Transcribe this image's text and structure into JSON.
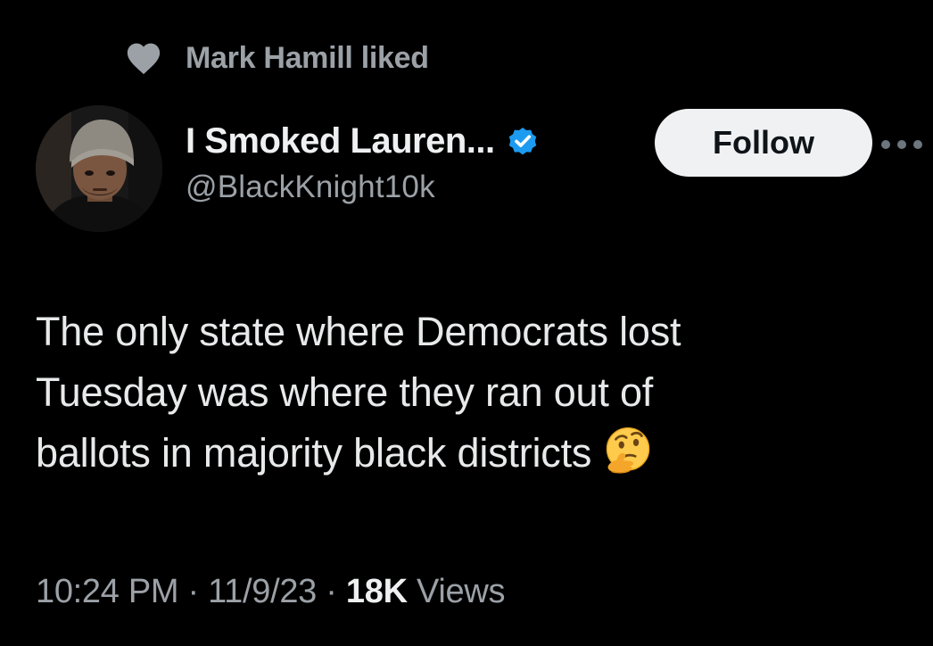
{
  "social_context": {
    "text": "Mark Hamill liked",
    "icon": "heart-icon"
  },
  "author": {
    "display_name": "I Smoked Lauren...",
    "handle": "@BlackKnight10k",
    "verified": true,
    "verified_color": "#1d9bf0"
  },
  "actions": {
    "follow_label": "Follow",
    "more_icon": "more-options-icon"
  },
  "tweet": {
    "lines": [
      "The only state where Democrats lost",
      "Tuesday was where they ran out of",
      "ballots in majority black districts"
    ],
    "emoji": "thinking-face-emoji"
  },
  "meta": {
    "time": "10:24 PM",
    "separator": "·",
    "date": "11/9/23",
    "views_count": "18K",
    "views_label": "Views"
  },
  "colors": {
    "background": "#000000",
    "primary_text": "#e7e9ea",
    "secondary_text": "#9ba1a6",
    "follow_button_bg": "#eff1f2"
  }
}
